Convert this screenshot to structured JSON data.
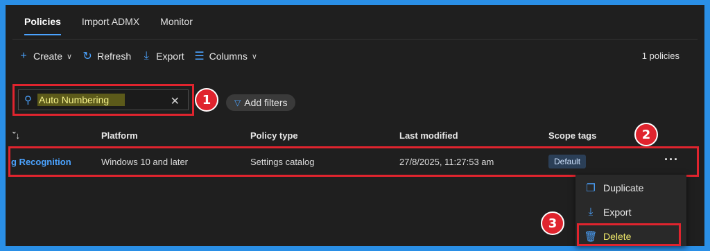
{
  "tabs": [
    {
      "label": "Policies",
      "active": true
    },
    {
      "label": "Import ADMX",
      "active": false
    },
    {
      "label": "Monitor",
      "active": false
    }
  ],
  "toolbar": {
    "create_label": "Create",
    "refresh_label": "Refresh",
    "export_label": "Export",
    "columns_label": "Columns"
  },
  "policy_count": "1 policies",
  "search": {
    "value": "Auto Numbering"
  },
  "add_filters_label": "Add filters",
  "table": {
    "headers": {
      "sort": "ˇ↓",
      "platform": "Platform",
      "policy_type": "Policy type",
      "last_modified": "Last modified",
      "scope_tags": "Scope tags"
    },
    "row": {
      "name": "g Recognition",
      "platform": "Windows 10 and later",
      "policy_type": "Settings catalog",
      "last_modified": "27/8/2025, 11:27:53 am",
      "scope_tag": "Default",
      "more": "···"
    }
  },
  "context_menu": {
    "duplicate": "Duplicate",
    "export": "Export",
    "delete": "Delete"
  },
  "callouts": {
    "one": "1",
    "two": "2",
    "three": "3"
  },
  "colors": {
    "accent": "#4ba3ff",
    "callout_red": "#e0242e",
    "frame_blue": "#2a8fe6",
    "highlight_yellow": "#f0e86a"
  }
}
